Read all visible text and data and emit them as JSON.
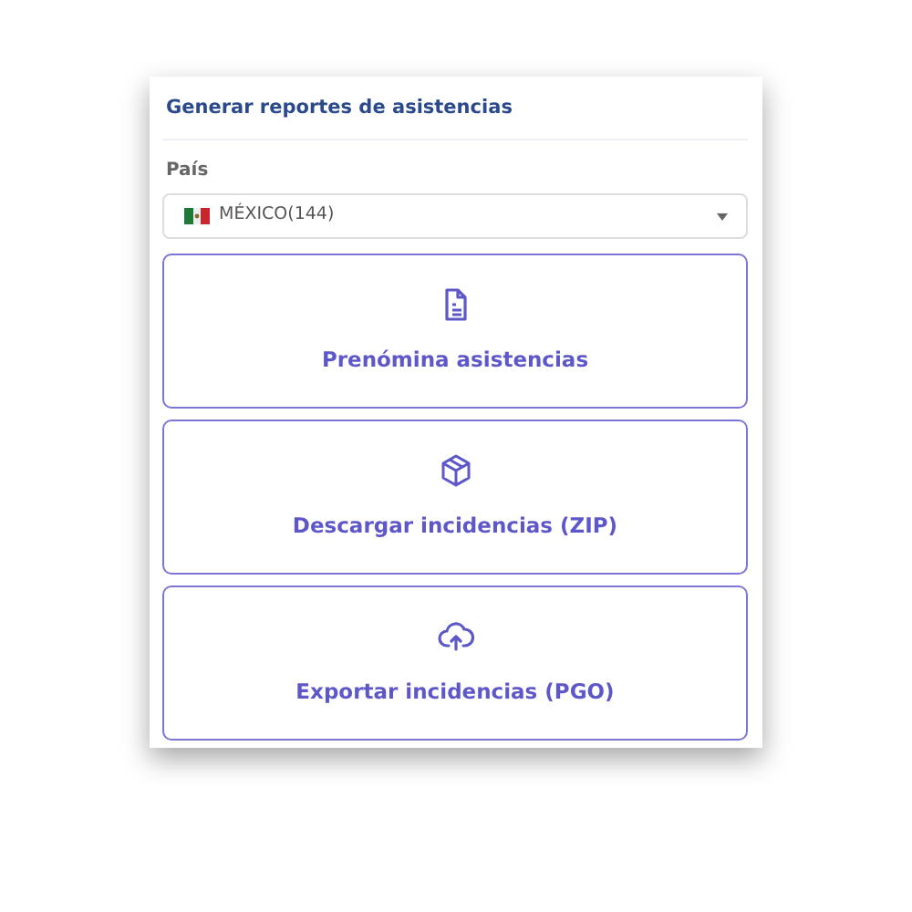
{
  "panel": {
    "title": "Generar reportes de asistencias"
  },
  "country_field": {
    "label": "País",
    "value": "MÉXICO(144)"
  },
  "actions": [
    {
      "kind": "document",
      "label": "Prenómina asistencias"
    },
    {
      "kind": "box",
      "label": "Descargar incidencias (ZIP)"
    },
    {
      "kind": "upload",
      "label": "Exportar incidencias (PGO)"
    }
  ]
}
